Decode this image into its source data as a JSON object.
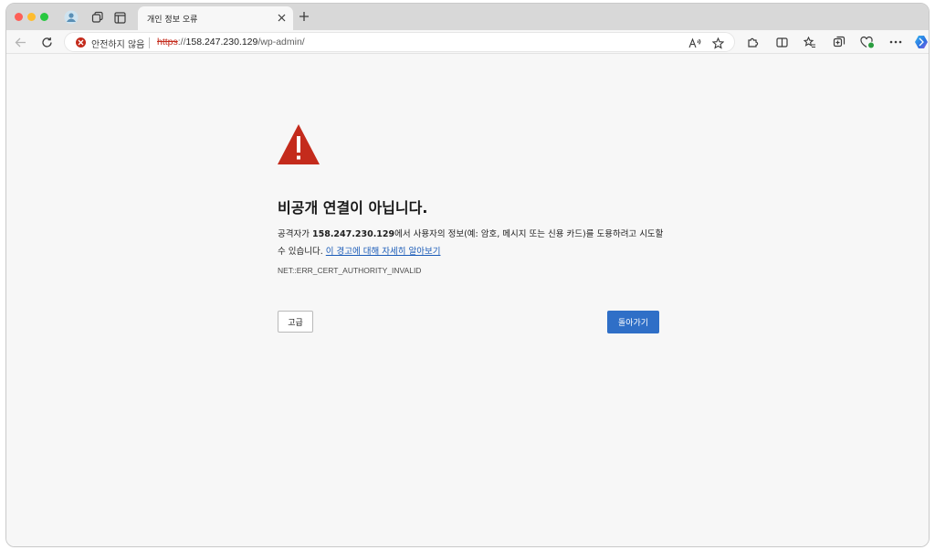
{
  "browser": {
    "tab": {
      "title": "개인 정보 오류",
      "close_icon": "close-icon"
    },
    "new_tab_icon": "plus-icon",
    "address_bar": {
      "security_label": "안전하지 않음",
      "url_scheme": "https",
      "url_separator": "://",
      "url_host": "158.247.230.129",
      "url_path": "/wp-admin/"
    }
  },
  "page": {
    "title": "비공개 연결이 아닙니다.",
    "description_prefix": "공격자가 ",
    "description_host": "158.247.230.129",
    "description_suffix": "에서 사용자의 정보(예: 암호, 메시지 또는 신용 카드)를 도용하려고 시도할 수 있습니다. ",
    "learn_more_link": "이 경고에 대해 자세히 알아보기",
    "error_code": "NET::ERR_CERT_AUTHORITY_INVALID",
    "advanced_button": "고급",
    "back_button": "돌아가기"
  },
  "colors": {
    "warning_red": "#c42b1c",
    "primary_button": "#2f6fc7",
    "link": "#1a5bb8"
  }
}
